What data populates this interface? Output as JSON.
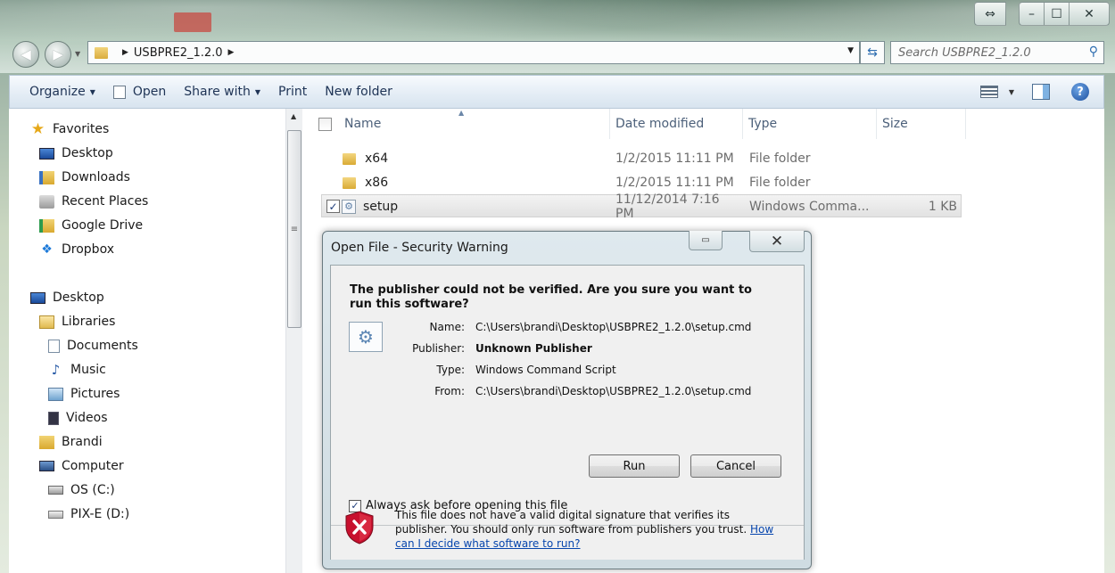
{
  "window": {
    "caption": {
      "resize": "⇔",
      "minimize": "–",
      "maximize": "☐",
      "close": "✕"
    }
  },
  "nav": {
    "back": "◀",
    "forward": "▶",
    "recent": "▼"
  },
  "address": {
    "crumb": "USBPRE2_1.2.0",
    "separator": "▶",
    "trailing": "▶",
    "dropdown": "▼"
  },
  "search": {
    "placeholder": "Search USBPRE2_1.2.0"
  },
  "toolbar": {
    "organize": "Organize",
    "open": "Open",
    "share_with": "Share with",
    "print": "Print",
    "new_folder": "New folder",
    "arrow": "▼",
    "help": "?"
  },
  "sidebar": {
    "favorites": {
      "header": "Favorites",
      "items": [
        "Desktop",
        "Downloads",
        "Recent Places",
        "Google Drive",
        "Dropbox"
      ]
    },
    "desktop": {
      "header": "Desktop",
      "libraries": "Libraries",
      "library_items": [
        "Documents",
        "Music",
        "Pictures",
        "Videos"
      ],
      "user": "Brandi",
      "computer": "Computer",
      "drives": [
        "OS (C:)",
        "PIX-E (D:)"
      ]
    }
  },
  "columns": {
    "name": "Name",
    "date": "Date modified",
    "type": "Type",
    "size": "Size",
    "sort": "▲"
  },
  "files": [
    {
      "name": "x64",
      "date": "1/2/2015 11:11 PM",
      "type": "File folder",
      "size": ""
    },
    {
      "name": "x86",
      "date": "1/2/2015 11:11 PM",
      "type": "File folder",
      "size": ""
    },
    {
      "name": "setup",
      "date": "11/12/2014 7:16 PM",
      "type": "Windows Comma...",
      "size": "1 KB"
    }
  ],
  "dialog": {
    "title": "Open File - Security Warning",
    "close_glyph": "✕",
    "help_glyph": "▭",
    "heading": "The publisher could not be verified.  Are you sure you want to run this software?",
    "fields": {
      "name_label": "Name:",
      "name_value": "C:\\Users\\brandi\\Desktop\\USBPRE2_1.2.0\\setup.cmd",
      "publisher_label": "Publisher:",
      "publisher_value": "Unknown Publisher",
      "type_label": "Type:",
      "type_value": "Windows Command Script",
      "from_label": "From:",
      "from_value": "C:\\Users\\brandi\\Desktop\\USBPRE2_1.2.0\\setup.cmd"
    },
    "run_label": "Run",
    "cancel_label": "Cancel",
    "always_ask": "Always ask before opening this file",
    "always_ask_checked": true,
    "warning_text": "This file does not have a valid digital signature that verifies its publisher. You should only run software from publishers you trust.",
    "warning_link": "How can I decide what software to run?"
  },
  "colors": {
    "accent": "#1e3355",
    "link": "#0645ad",
    "shield": "#c8102e"
  }
}
